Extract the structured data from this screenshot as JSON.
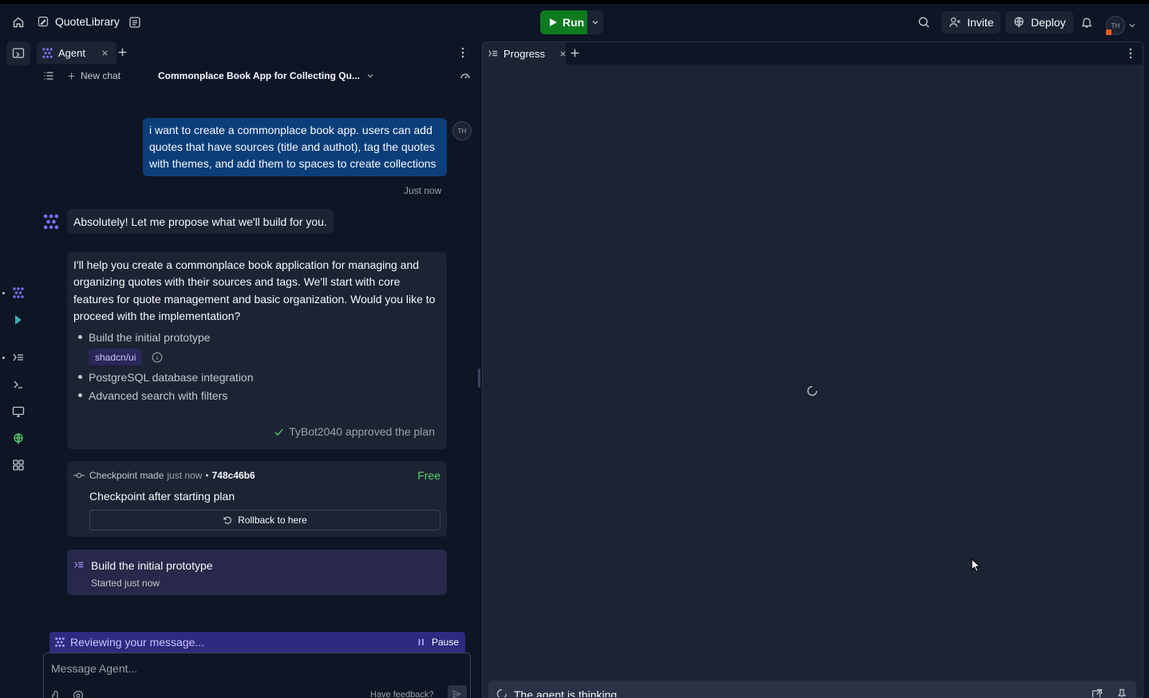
{
  "header": {
    "project_name": "QuoteLibrary",
    "run_label": "Run",
    "invite_label": "Invite",
    "deploy_label": "Deploy",
    "avatar_initials": "TH"
  },
  "agent_tab": {
    "label": "Agent",
    "new_chat_label": "New chat",
    "chat_title": "Commonplace Book App for Collecting Qu..."
  },
  "chat": {
    "user_message": "i want to create a commonplace book app. users can add quotes that have sources (title and authot), tag the quotes with themes, and add them to spaces to create collections",
    "user_initials": "TH",
    "user_time": "Just now",
    "agent_reply": "Absolutely! Let me propose what we'll build for you.",
    "plan_intro": "I'll help you create a commonplace book application for managing and organizing quotes with their sources and tags. We'll start with core features for quote management and basic organization. Would you like to proceed with the implementation?",
    "plan_items": [
      "Build the initial prototype",
      "PostgreSQL database integration",
      "Advanced search with filters"
    ],
    "plan_tag": "shadcn/ui",
    "approved_text": "TyBot2040 approved the plan",
    "checkpoint": {
      "made_label": "Checkpoint made",
      "when": "just now",
      "separator": "•",
      "hash": "748c46b6",
      "price": "Free",
      "title": "Checkpoint after starting plan",
      "rollback_label": "Rollback to here"
    },
    "task": {
      "title": "Build the initial prototype",
      "status": "Started just now"
    }
  },
  "composer": {
    "status_text": "Reviewing your message...",
    "pause_label": "Pause",
    "placeholder": "Message Agent...",
    "feedback_label": "Have feedback?"
  },
  "progress": {
    "tab_label": "Progress",
    "thinking_text": "The agent is thinking."
  },
  "colors": {
    "background": "#0e1525",
    "surface": "#1c2333",
    "run_green": "#0e7a1e",
    "user_bubble": "#0c3e7a",
    "accent_purple": "#7c6cf2",
    "free_green": "#58d26f"
  }
}
